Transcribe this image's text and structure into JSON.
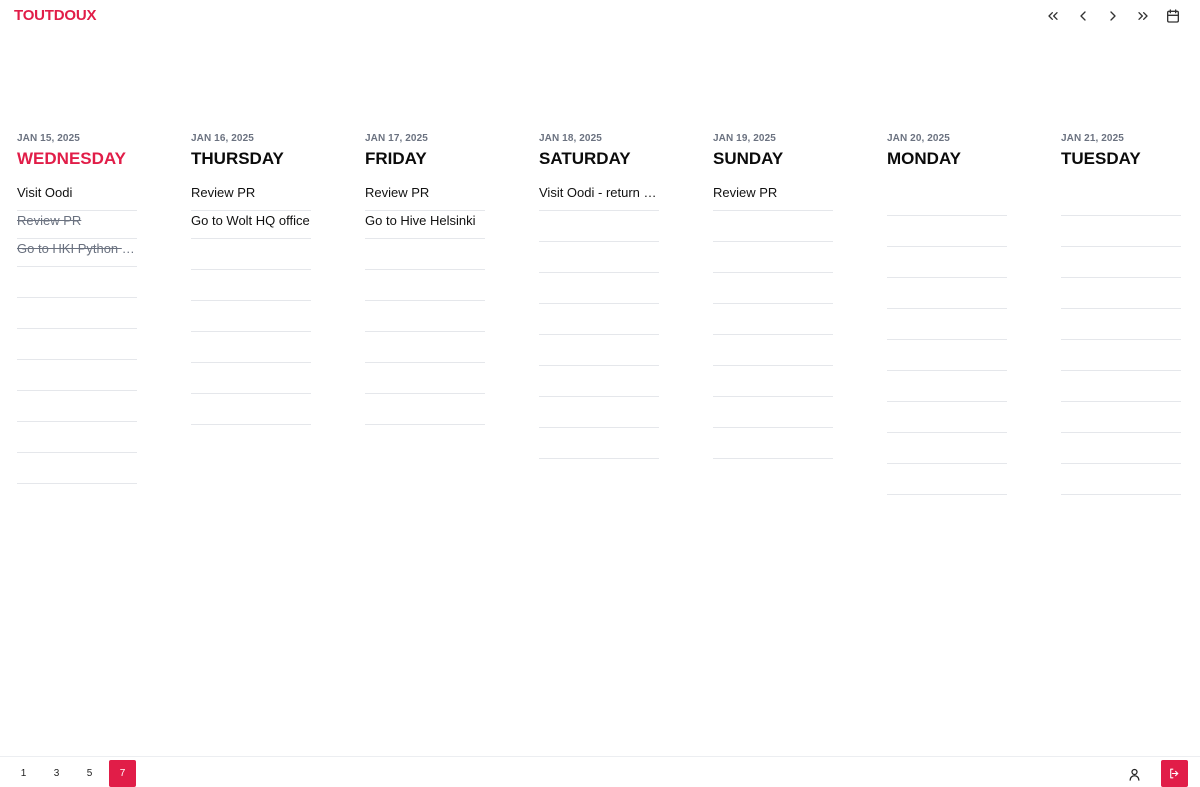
{
  "app": {
    "title": "TOUTDOUX",
    "accent": "#e11d48"
  },
  "nav": {
    "icons": [
      "double-chevron-left-icon",
      "chevron-left-icon",
      "chevron-right-icon",
      "double-chevron-right-icon",
      "calendar-icon"
    ]
  },
  "days": [
    {
      "date": "JAN 15, 2025",
      "weekday": "WEDNESDAY",
      "today": true,
      "todos": [
        {
          "text": "Visit Oodi",
          "done": false
        },
        {
          "text": "Review PR",
          "done": true
        },
        {
          "text": "Go to HKI Python M…",
          "done": true
        }
      ]
    },
    {
      "date": "JAN 16, 2025",
      "weekday": "THURSDAY",
      "today": false,
      "todos": [
        {
          "text": "Review PR",
          "done": false
        },
        {
          "text": "Go to Wolt HQ office",
          "done": false
        }
      ]
    },
    {
      "date": "JAN 17, 2025",
      "weekday": "FRIDAY",
      "today": false,
      "todos": [
        {
          "text": "Review PR",
          "done": false
        },
        {
          "text": "Go to Hive Helsinki",
          "done": false
        }
      ]
    },
    {
      "date": "JAN 18, 2025",
      "weekday": "SATURDAY",
      "today": false,
      "todos": [
        {
          "text": "Visit Oodi - return bo…",
          "done": false
        }
      ]
    },
    {
      "date": "JAN 19, 2025",
      "weekday": "SUNDAY",
      "today": false,
      "todos": [
        {
          "text": "Review PR",
          "done": false
        }
      ]
    },
    {
      "date": "JAN 20, 2025",
      "weekday": "MONDAY",
      "today": false,
      "todos": []
    },
    {
      "date": "JAN 21, 2025",
      "weekday": "TUESDAY",
      "today": false,
      "todos": []
    }
  ],
  "footer": {
    "pages": [
      "1",
      "3",
      "5",
      "7"
    ],
    "active_page": "7",
    "icons": [
      "user-icon",
      "logout-icon"
    ]
  }
}
